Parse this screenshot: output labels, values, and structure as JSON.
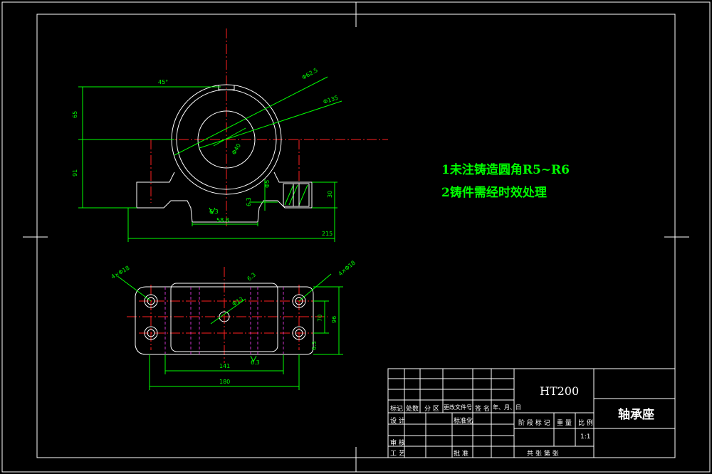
{
  "notes": {
    "line1": "1未注铸造圆角R5~R6",
    "line2": "2铸件需经时效处理"
  },
  "title_block": {
    "material": "HT200",
    "part_name": "轴承座",
    "scale_value": "1:1",
    "labels": {
      "mark": "标记",
      "count": "处数",
      "zone": "分 区",
      "change_doc": "更改文件号",
      "sign": "签 名",
      "date": "年、月、日",
      "design": "设 计",
      "standardize": "标准化",
      "review": "审 核",
      "process": "工 艺",
      "approve": "批 准",
      "stage_mark": "阶 段 标 记",
      "weight": "重 量",
      "scale": "比 例",
      "sheets": "共   张   第   张"
    }
  },
  "dimensions": {
    "front": {
      "top_angle": "45°",
      "height_upper": "65",
      "height_lower": "91",
      "dia_outer": "Φ62.5",
      "dia_shaft": "Φ135",
      "dia_bore": "Φ40",
      "base_recess": "58.8",
      "foot_height": "30",
      "overall_length": "215",
      "small_hole": "Φ5",
      "tol_a": "6.3",
      "tol_b": "6.3"
    },
    "top": {
      "hole_left": "4×Φ18",
      "hole_right": "4×Φ18",
      "center_hole": "Φ13",
      "width_inner": "141",
      "width_outer": "180",
      "height_inner": "70",
      "height_outer": "96",
      "tol_a": "6.3",
      "tol_b": "6.3",
      "tol_c": "6.3"
    }
  }
}
